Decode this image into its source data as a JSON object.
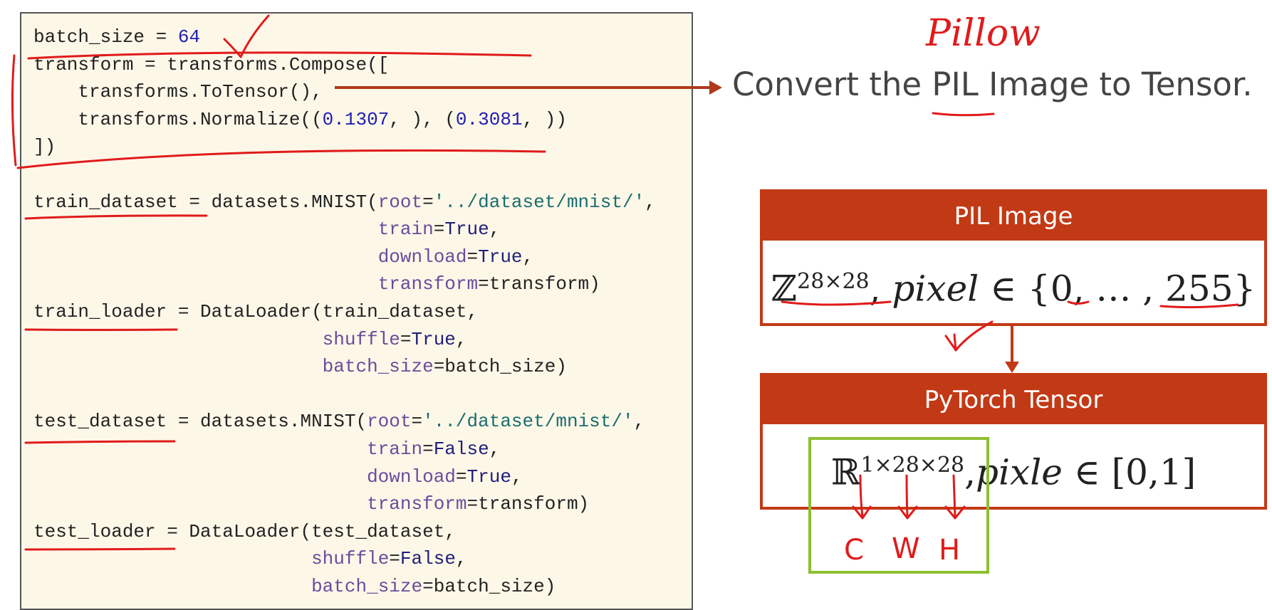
{
  "code": {
    "lines": [
      {
        "parts": [
          {
            "t": "batch_size = ",
            "c": ""
          },
          {
            "t": "64",
            "c": "num"
          }
        ]
      },
      {
        "parts": [
          {
            "t": "transform = transforms.Compose([",
            "c": ""
          }
        ]
      },
      {
        "parts": [
          {
            "t": "    transforms.ToTensor(),",
            "c": ""
          }
        ]
      },
      {
        "parts": [
          {
            "t": "    transforms.Normalize((",
            "c": ""
          },
          {
            "t": "0.1307",
            "c": "num"
          },
          {
            "t": ", ), (",
            "c": ""
          },
          {
            "t": "0.3081",
            "c": "num"
          },
          {
            "t": ", ))",
            "c": ""
          }
        ]
      },
      {
        "parts": [
          {
            "t": "])",
            "c": ""
          }
        ]
      },
      {
        "parts": []
      },
      {
        "parts": [
          {
            "t": "train_dataset = datasets.MNIST(",
            "c": ""
          },
          {
            "t": "root",
            "c": "arg"
          },
          {
            "t": "=",
            "c": ""
          },
          {
            "t": "'../dataset/mnist/'",
            "c": "str"
          },
          {
            "t": ",",
            "c": ""
          }
        ]
      },
      {
        "parts": [
          {
            "t": "                               ",
            "c": ""
          },
          {
            "t": "train",
            "c": "arg"
          },
          {
            "t": "=",
            "c": ""
          },
          {
            "t": "True",
            "c": "kw"
          },
          {
            "t": ",",
            "c": ""
          }
        ]
      },
      {
        "parts": [
          {
            "t": "                               ",
            "c": ""
          },
          {
            "t": "download",
            "c": "arg"
          },
          {
            "t": "=",
            "c": ""
          },
          {
            "t": "True",
            "c": "kw"
          },
          {
            "t": ",",
            "c": ""
          }
        ]
      },
      {
        "parts": [
          {
            "t": "                               ",
            "c": ""
          },
          {
            "t": "transform",
            "c": "arg"
          },
          {
            "t": "=transform)",
            "c": ""
          }
        ]
      },
      {
        "parts": [
          {
            "t": "train_loader = DataLoader(train_dataset,",
            "c": ""
          }
        ]
      },
      {
        "parts": [
          {
            "t": "                          ",
            "c": ""
          },
          {
            "t": "shuffle",
            "c": "arg"
          },
          {
            "t": "=",
            "c": ""
          },
          {
            "t": "True",
            "c": "kw"
          },
          {
            "t": ",",
            "c": ""
          }
        ]
      },
      {
        "parts": [
          {
            "t": "                          ",
            "c": ""
          },
          {
            "t": "batch_size",
            "c": "arg"
          },
          {
            "t": "=batch_size)",
            "c": ""
          }
        ]
      },
      {
        "parts": []
      },
      {
        "parts": [
          {
            "t": "test_dataset = datasets.MNIST(",
            "c": ""
          },
          {
            "t": "root",
            "c": "arg"
          },
          {
            "t": "=",
            "c": ""
          },
          {
            "t": "'../dataset/mnist/'",
            "c": "str"
          },
          {
            "t": ",",
            "c": ""
          }
        ]
      },
      {
        "parts": [
          {
            "t": "                              ",
            "c": ""
          },
          {
            "t": "train",
            "c": "arg"
          },
          {
            "t": "=",
            "c": ""
          },
          {
            "t": "False",
            "c": "kw"
          },
          {
            "t": ",",
            "c": ""
          }
        ]
      },
      {
        "parts": [
          {
            "t": "                              ",
            "c": ""
          },
          {
            "t": "download",
            "c": "arg"
          },
          {
            "t": "=",
            "c": ""
          },
          {
            "t": "True",
            "c": "kw"
          },
          {
            "t": ",",
            "c": ""
          }
        ]
      },
      {
        "parts": [
          {
            "t": "                              ",
            "c": ""
          },
          {
            "t": "transform",
            "c": "arg"
          },
          {
            "t": "=transform)",
            "c": ""
          }
        ]
      },
      {
        "parts": [
          {
            "t": "test_loader = DataLoader(test_dataset,",
            "c": ""
          }
        ]
      },
      {
        "parts": [
          {
            "t": "                         ",
            "c": ""
          },
          {
            "t": "shuffle",
            "c": "arg"
          },
          {
            "t": "=",
            "c": ""
          },
          {
            "t": "False",
            "c": "kw"
          },
          {
            "t": ",",
            "c": ""
          }
        ]
      },
      {
        "parts": [
          {
            "t": "                         ",
            "c": ""
          },
          {
            "t": "batch_size",
            "c": "arg"
          },
          {
            "t": "=batch_size)",
            "c": ""
          }
        ]
      }
    ]
  },
  "convert_text": "Convert the PIL Image to Tensor.",
  "handwriting": {
    "pillow": "Pillow",
    "c": "C",
    "w": "W",
    "h": "H"
  },
  "pil_box": {
    "header": "PIL Image",
    "set": "ℤ",
    "sup": "28×28",
    "rest_a": ", ",
    "var": "pixel",
    "rest_b": " ∈ {0, … , 255}"
  },
  "tensor_box": {
    "header": "PyTorch Tensor",
    "set": "ℝ",
    "sup": "1×28×28",
    "rest_a": ",",
    "var": "pixle",
    "rest_b": " ∈ [0,1]"
  },
  "colors": {
    "accent": "#c23a15",
    "annotation": "#e01b1b",
    "highlight_box": "#8dc030",
    "panel_bg": "#fdf7e8"
  }
}
